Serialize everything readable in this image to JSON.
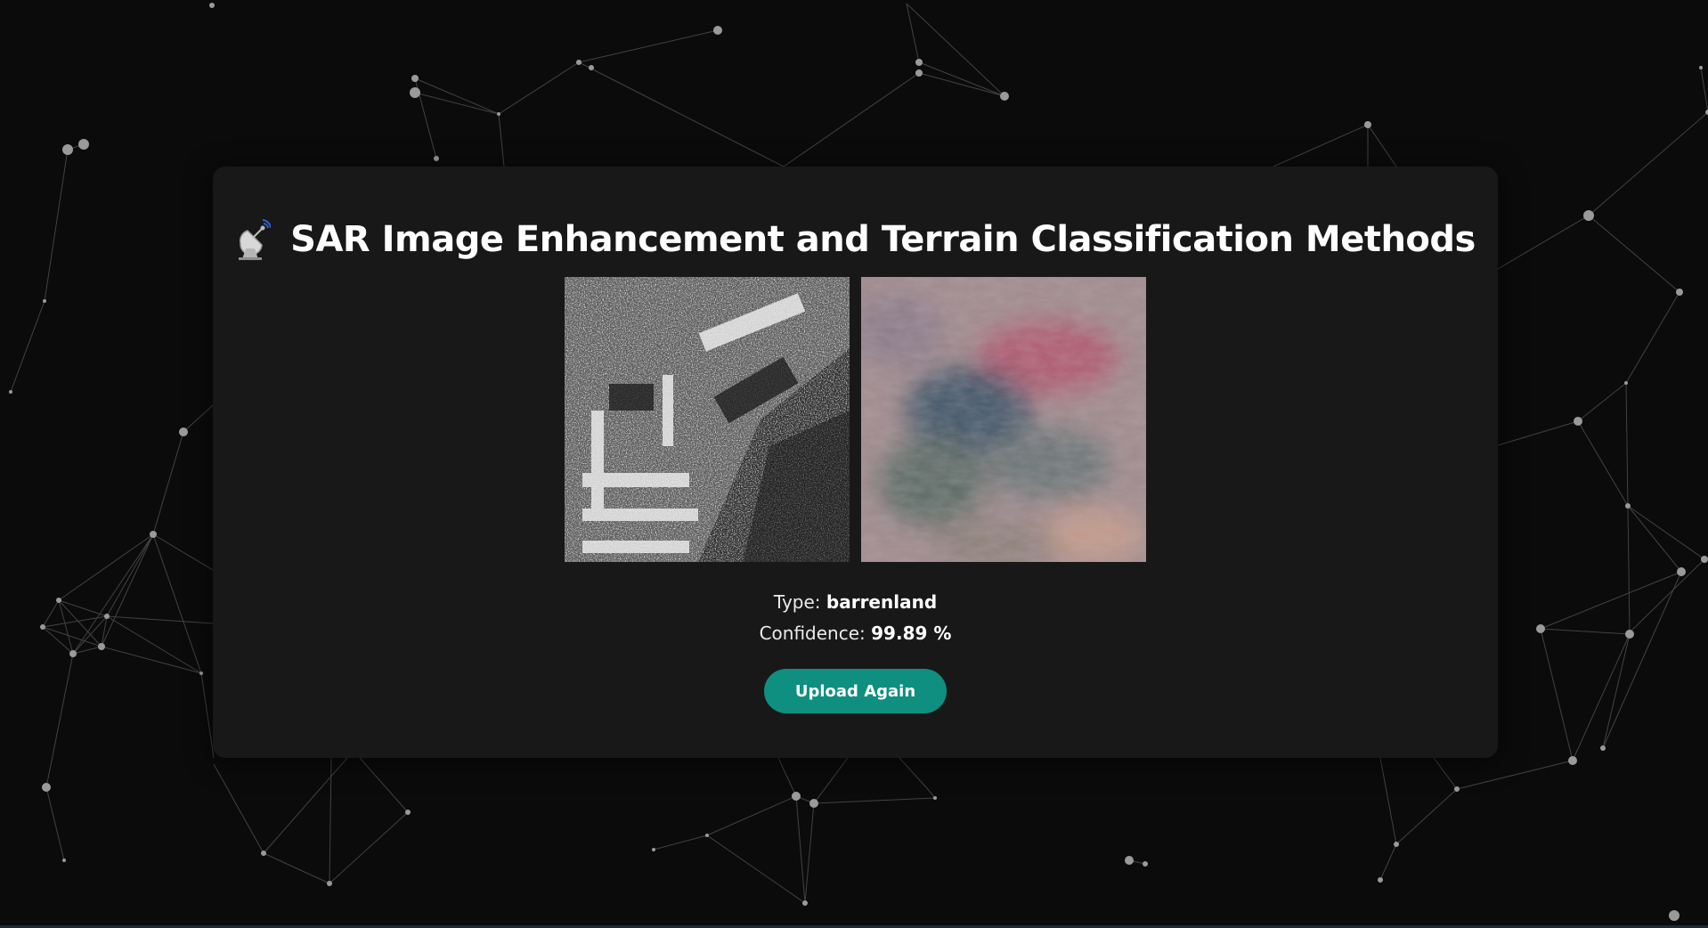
{
  "header": {
    "icon": "satellite-dish-icon",
    "title": "SAR Image Enhancement and Terrain Classification Methods"
  },
  "images": {
    "sar_input": "sar-grayscale-image",
    "enhanced_output": "colorized-terrain-image"
  },
  "result": {
    "type_label": "Type:",
    "type_value": "barrenland",
    "confidence_label": "Confidence:",
    "confidence_value": "99.89 %"
  },
  "actions": {
    "upload_again_label": "Upload Again"
  },
  "colors": {
    "background": "#0b0b0b",
    "card": "#181818",
    "accent": "#0e8f80",
    "network_lines": "#8a8a8a"
  }
}
